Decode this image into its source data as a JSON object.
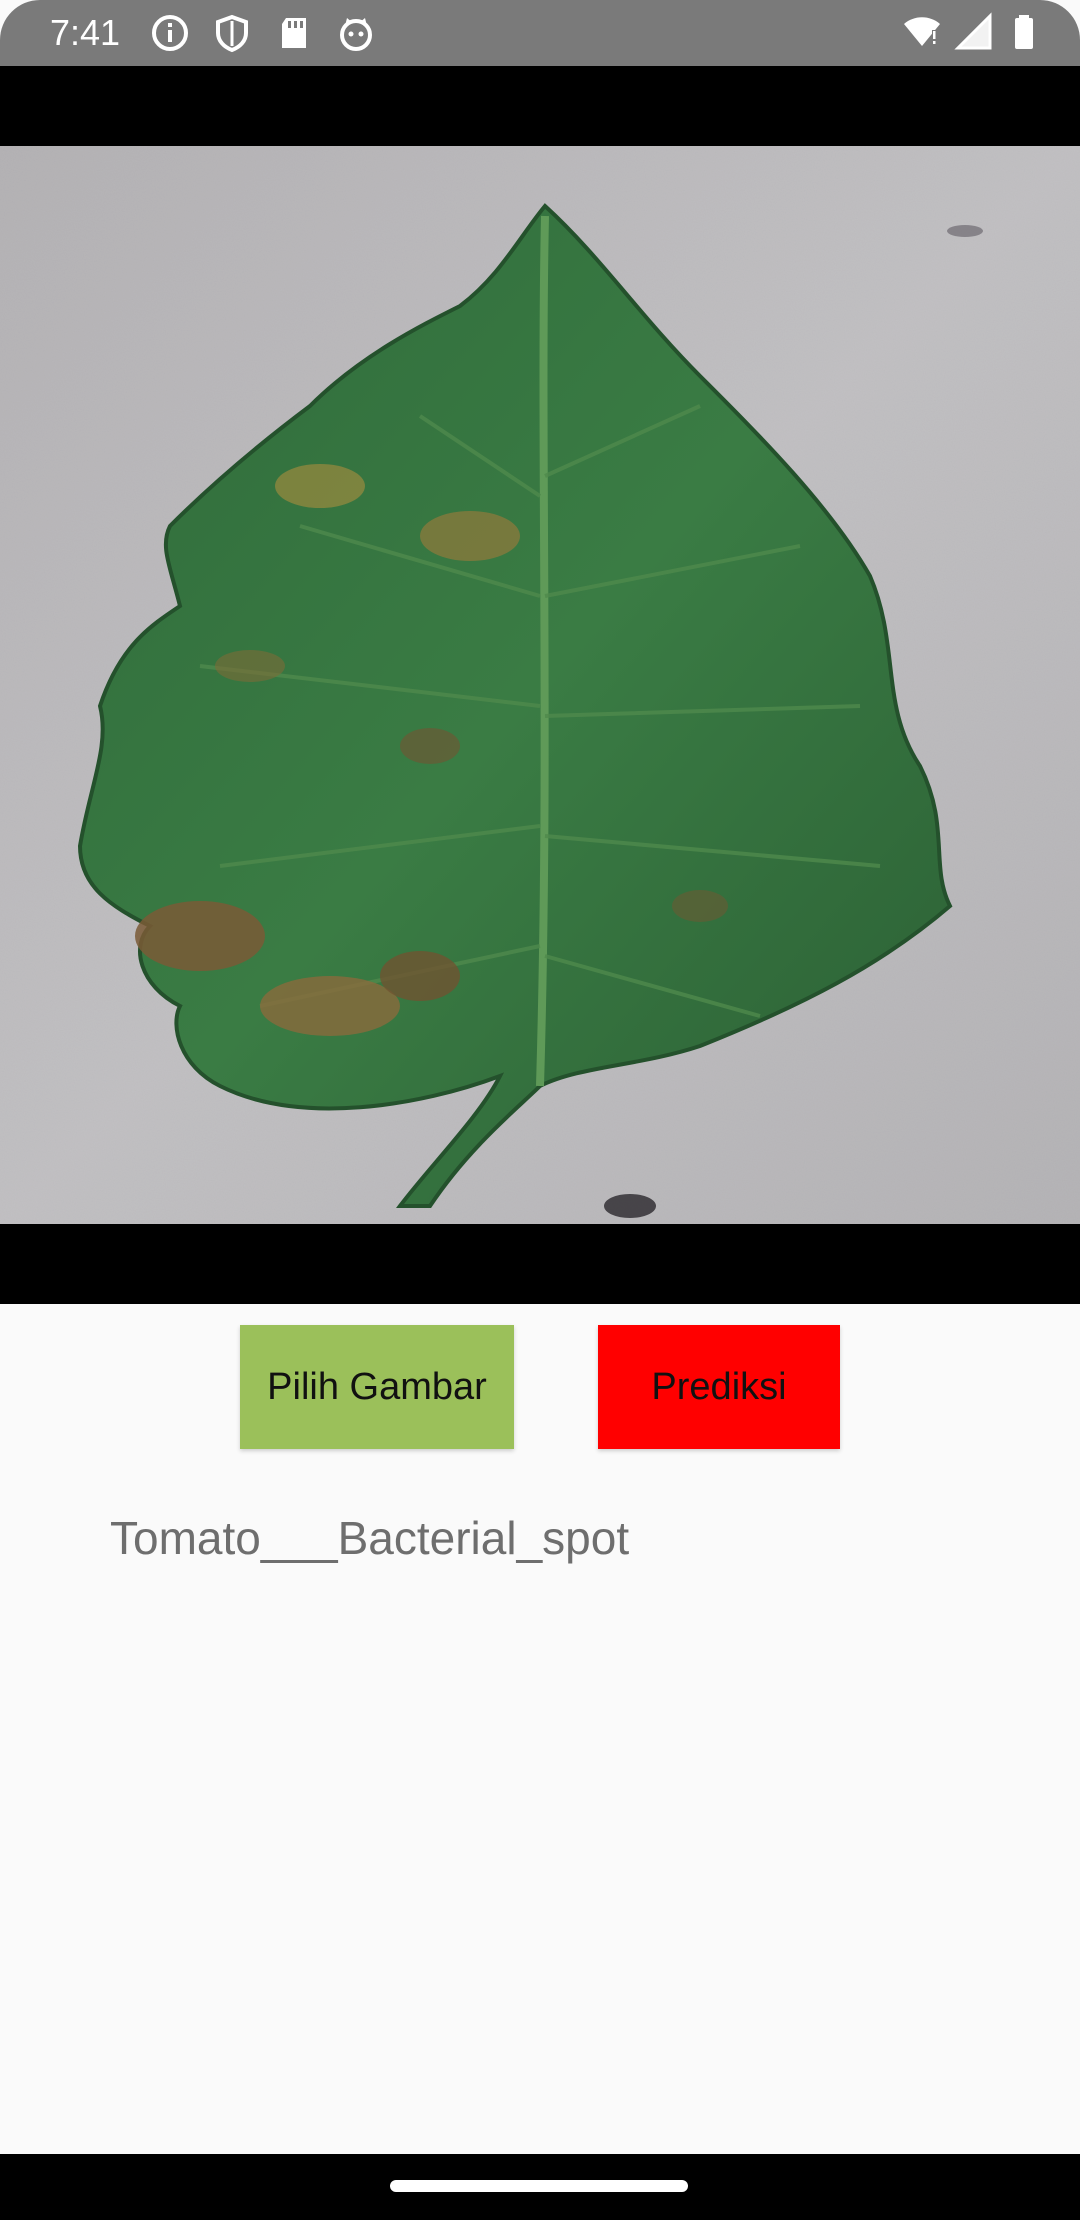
{
  "status_bar": {
    "time": "7:41",
    "icons_left": [
      "info-icon",
      "shield-icon",
      "sd-card-icon",
      "cat-icon"
    ],
    "icons_right": [
      "wifi-icon",
      "signal-icon",
      "battery-icon"
    ]
  },
  "image": {
    "description_icon": "leaf-photo"
  },
  "buttons": {
    "pick_label": "Pilih Gambar",
    "predict_label": "Prediksi"
  },
  "result": {
    "text": "Tomato___Bacterial_spot"
  },
  "colors": {
    "pick_button": "#9bc05a",
    "predict_button": "#ff0000",
    "result_text": "#6e6e6e"
  }
}
